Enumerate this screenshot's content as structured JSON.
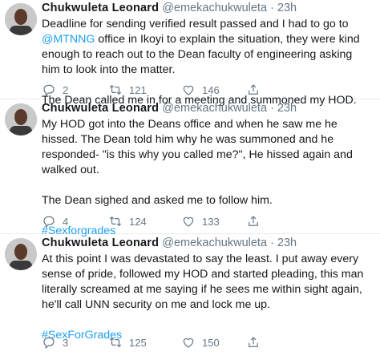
{
  "tweets": [
    {
      "author": "Chukwuleta Leonard",
      "handle": "@emekachukwuleta",
      "time": "· 23h",
      "text_pre": "Deadline for sending verified result passed and I had to go to ",
      "mention": "@MTNNG",
      "text_post": " office in Ikoyi to explain the situation, they were kind enough to reach out to the Dean faculty of engineering asking him to look into the matter.",
      "text2": "The Dean called me in for a meeting and summoned my HOD.",
      "replies": "2",
      "retweets": "121",
      "likes": "146"
    },
    {
      "author": "Chukwuleta Leonard",
      "handle": "@emekachukwuleta",
      "time": "· 23h",
      "text1": "My HOD got into the Deans office and when he saw me he hissed. The Dean told him why he was summoned and he responded- \"is this why you called me?\", He hissed again and walked out.",
      "text2": "The Dean sighed and asked me to follow him.",
      "hashtag": "#Sexforgrades",
      "replies": "4",
      "retweets": "124",
      "likes": "133"
    },
    {
      "author": "Chukwuleta Leonard",
      "handle": "@emekachukwuleta",
      "time": "· 23h",
      "text1": "At this point I was devastated to say the least. I put away every sense of pride, followed my HOD and started pleading, this man literally screamed at me saying if he sees me within sight again, he'll call UNN security on me and lock me up.",
      "hashtag": "#SexForGrades",
      "replies": "3",
      "retweets": "125",
      "likes": "150"
    }
  ]
}
